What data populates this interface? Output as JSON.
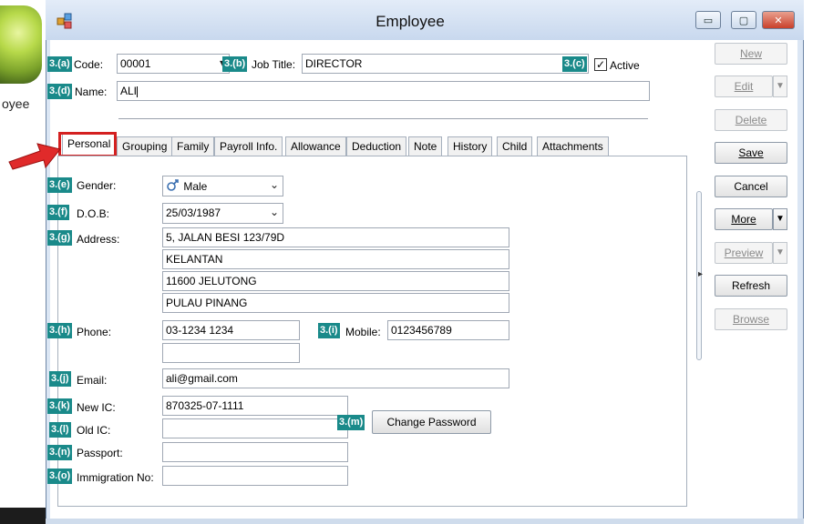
{
  "background_app": {
    "text": "oyee"
  },
  "window": {
    "title": "Employee",
    "controls": {
      "minimize": "▭",
      "maximize": "▢",
      "close": "✕"
    }
  },
  "header": {
    "code_label": "Code:",
    "code_value": "00001",
    "job_title_label": "Job Title:",
    "job_title_value": "DIRECTOR",
    "active_label": "Active",
    "active_checked": true,
    "name_label": "Name:",
    "name_value": "ALI"
  },
  "tags": {
    "a": "3.(a)",
    "b": "3.(b)",
    "c": "3.(c)",
    "d": "3.(d)",
    "e": "3.(e)",
    "f": "3.(f)",
    "g": "3.(g)",
    "h": "3.(h)",
    "i": "3.(i)",
    "j": "3.(j)",
    "k": "3.(k)",
    "l": "3.(l)",
    "m": "3.(m)",
    "n": "3.(n)",
    "o": "3.(o)"
  },
  "tabs": [
    "Personal",
    "Grouping",
    "Family",
    "Payroll Info.",
    "Allowance",
    "Deduction",
    "Note",
    "History",
    "Child",
    "Attachments"
  ],
  "active_tab": "Personal",
  "personal": {
    "gender_label": "Gender:",
    "gender_value": "Male",
    "gender_icon": "male-icon",
    "dob_label": "D.O.B:",
    "dob_value": "25/03/1987",
    "address_label": "Address:",
    "address_lines": [
      "5, JALAN BESI 123/79D",
      "KELANTAN",
      "11600 JELUTONG",
      "PULAU PINANG"
    ],
    "phone_label": "Phone:",
    "phone_value": "03-1234 1234",
    "phone2_value": "",
    "mobile_label": "Mobile:",
    "mobile_value": "0123456789",
    "email_label": "Email:",
    "email_value": "ali@gmail.com",
    "new_ic_label": "New IC:",
    "new_ic_value": "870325-07-1111",
    "old_ic_label": "Old IC:",
    "old_ic_value": "",
    "change_password_label": "Change Password",
    "passport_label": "Passport:",
    "passport_value": "",
    "immigration_label": "Immigration No:",
    "immigration_value": ""
  },
  "actions": {
    "new": "New",
    "edit": "Edit",
    "delete": "Delete",
    "save": "Save",
    "cancel": "Cancel",
    "more": "More",
    "preview": "Preview",
    "refresh": "Refresh",
    "browse": "Browse"
  },
  "colors": {
    "tag_bg": "#1a8a8a",
    "highlight_red": "#d42020",
    "window_frame": "#dbe6f4"
  }
}
